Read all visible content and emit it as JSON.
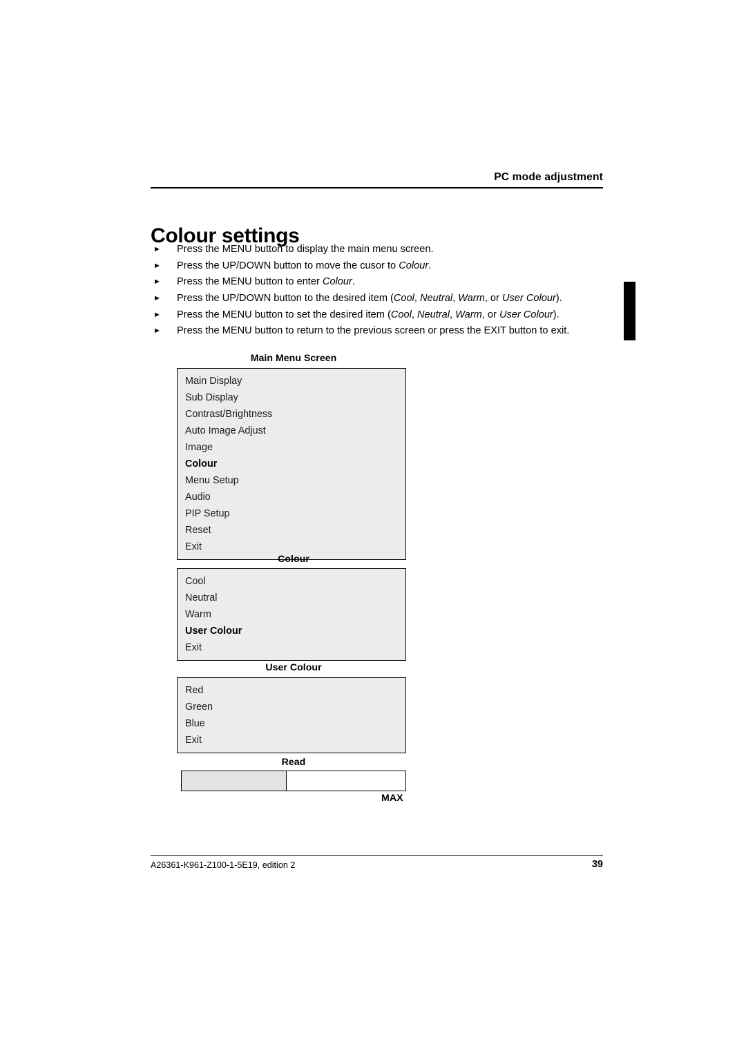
{
  "header": {
    "running_head": "PC mode adjustment"
  },
  "title": "Colour settings",
  "bullets": [
    {
      "marker": "►",
      "segments": [
        {
          "text": "Press the MENU button to display the main menu screen.",
          "italic": false
        }
      ]
    },
    {
      "marker": "►",
      "segments": [
        {
          "text": "Press the UP/DOWN button to move the cusor to ",
          "italic": false
        },
        {
          "text": "Colour",
          "italic": true
        },
        {
          "text": ".",
          "italic": false
        }
      ]
    },
    {
      "marker": "►",
      "segments": [
        {
          "text": "Press the MENU  button to enter ",
          "italic": false
        },
        {
          "text": "Colour",
          "italic": true
        },
        {
          "text": ".",
          "italic": false
        }
      ]
    },
    {
      "marker": "►",
      "segments": [
        {
          "text": "Press the UP/DOWN button to the desired item (",
          "italic": false
        },
        {
          "text": "Cool",
          "italic": true
        },
        {
          "text": ", ",
          "italic": false
        },
        {
          "text": "Neutral",
          "italic": true
        },
        {
          "text": ", ",
          "italic": false
        },
        {
          "text": "Warm",
          "italic": true
        },
        {
          "text": ", or ",
          "italic": false
        },
        {
          "text": "User Colour",
          "italic": true
        },
        {
          "text": ").",
          "italic": false
        }
      ]
    },
    {
      "marker": "►",
      "segments": [
        {
          "text": "Press the MENU button to set the desired item (",
          "italic": false
        },
        {
          "text": "Cool",
          "italic": true
        },
        {
          "text": ", ",
          "italic": false
        },
        {
          "text": "Neutral",
          "italic": true
        },
        {
          "text": ", ",
          "italic": false
        },
        {
          "text": "Warm",
          "italic": true
        },
        {
          "text": ", or ",
          "italic": false
        },
        {
          "text": "User Colour",
          "italic": true
        },
        {
          "text": ").",
          "italic": false
        }
      ]
    },
    {
      "marker": "►",
      "segments": [
        {
          "text": "Press the MENU button to return to the previous screen or press the EXIT button to exit.",
          "italic": false
        }
      ]
    }
  ],
  "menus": [
    {
      "caption": "Main Menu Screen",
      "items": [
        {
          "label": "Main Display",
          "selected": false
        },
        {
          "label": "Sub Display",
          "selected": false
        },
        {
          "label": "Contrast/Brightness",
          "selected": false
        },
        {
          "label": "Auto Image Adjust",
          "selected": false
        },
        {
          "label": "Image",
          "selected": false
        },
        {
          "label": "Colour",
          "selected": true
        },
        {
          "label": "Menu Setup",
          "selected": false
        },
        {
          "label": "Audio",
          "selected": false
        },
        {
          "label": "PIP Setup",
          "selected": false
        },
        {
          "label": "Reset",
          "selected": false
        },
        {
          "label": "Exit",
          "selected": false
        }
      ]
    },
    {
      "caption": "Colour",
      "items": [
        {
          "label": "Cool",
          "selected": false
        },
        {
          "label": "Neutral",
          "selected": false
        },
        {
          "label": "Warm",
          "selected": false
        },
        {
          "label": "User Colour",
          "selected": true
        },
        {
          "label": "Exit",
          "selected": false
        }
      ]
    },
    {
      "caption": "User Colour",
      "items": [
        {
          "label": "Red",
          "selected": false
        },
        {
          "label": "Green",
          "selected": false
        },
        {
          "label": "Blue",
          "selected": false
        },
        {
          "label": "Exit",
          "selected": false
        }
      ]
    }
  ],
  "slider": {
    "caption": "Read",
    "fill_percent": 47,
    "max_label": "MAX"
  },
  "footer": {
    "left": "A26361-K961-Z100-1-5E19, edition 2",
    "page_number": "39"
  }
}
